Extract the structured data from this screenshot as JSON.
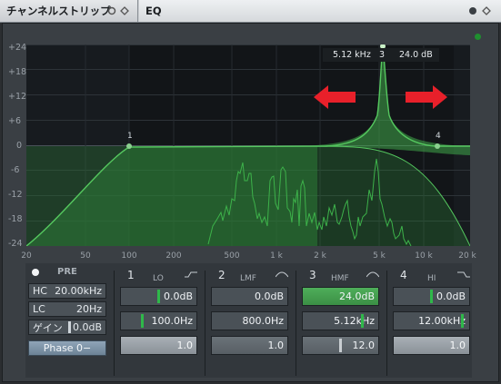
{
  "tabs": [
    {
      "label": "チャンネルストリップ"
    },
    {
      "label": "EQ"
    }
  ],
  "graph": {
    "y_ticks": [
      "+24",
      "+18",
      "+12",
      "+6",
      "0",
      "-6",
      "-12",
      "-18",
      "-24"
    ],
    "x_ticks": [
      "20",
      "50",
      "100",
      "200",
      "500",
      "1 k",
      "2 k",
      "5 k",
      "10 k",
      "20 k"
    ],
    "readout": {
      "freq": "5.12 kHz",
      "band": "3",
      "gain": "24.0 dB"
    },
    "point_labels": [
      "1",
      "4"
    ]
  },
  "left": {
    "pre": "PRE",
    "hc_label": "HC",
    "hc_value": "20.00kHz",
    "lc_label": "LC",
    "lc_value": "20Hz",
    "gain_label": "ゲイン",
    "gain_value": "0.0dB",
    "phase": "Phase 0−"
  },
  "bands": [
    {
      "num": "1",
      "name": "LO",
      "gain": "0.0dB",
      "freq": "100.0Hz",
      "q": "1.0"
    },
    {
      "num": "2",
      "name": "LMF",
      "gain": "0.0dB",
      "freq": "800.0Hz",
      "q": "1.0"
    },
    {
      "num": "3",
      "name": "HMF",
      "gain": "24.0dB",
      "freq": "5.12kHz",
      "q": "12.0"
    },
    {
      "num": "4",
      "name": "HI",
      "gain": "0.0dB",
      "freq": "12.00kHz",
      "q": "1.0"
    }
  ],
  "colors": {
    "accent": "#2fb84a",
    "arrow": "#e8202a"
  }
}
